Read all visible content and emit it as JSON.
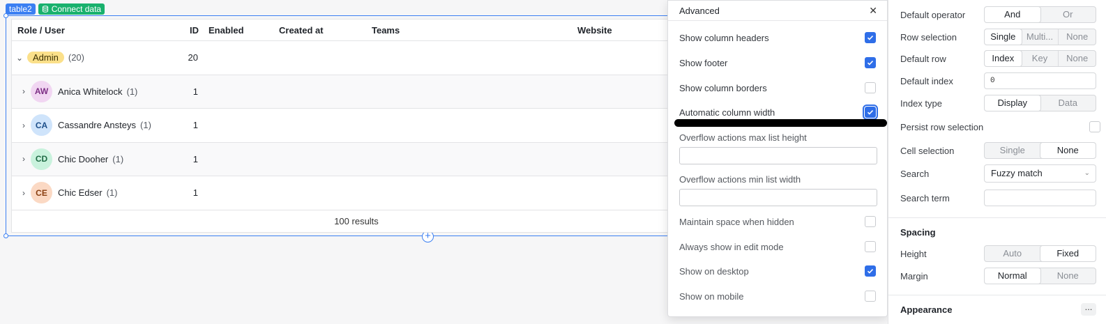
{
  "component": {
    "name_tag": "table2",
    "connect_label": "Connect data"
  },
  "table": {
    "columns": [
      "Role / User",
      "ID",
      "Enabled",
      "Created at",
      "Teams",
      "Website"
    ],
    "group": {
      "label": "Admin",
      "count": "(20)",
      "id": "20"
    },
    "rows": [
      {
        "initials": "AW",
        "name": "Anica Whitelock",
        "count": "(1)",
        "id": "1",
        "avatar_bg": "#f1d6f2",
        "avatar_fg": "#7d2f85"
      },
      {
        "initials": "CA",
        "name": "Cassandre Ansteys",
        "count": "(1)",
        "id": "1",
        "avatar_bg": "#cfe4fb",
        "avatar_fg": "#1d4f8a"
      },
      {
        "initials": "CD",
        "name": "Chic Dooher",
        "count": "(1)",
        "id": "1",
        "avatar_bg": "#c9f2dd",
        "avatar_fg": "#1f6b45"
      },
      {
        "initials": "CE",
        "name": "Chic Edser",
        "count": "(1)",
        "id": "1",
        "avatar_bg": "#fbd9c4",
        "avatar_fg": "#8a3f12"
      }
    ],
    "footer": "100 results"
  },
  "advanced": {
    "title": "Advanced",
    "show_column_headers": "Show column headers",
    "show_footer": "Show footer",
    "show_column_borders": "Show column borders",
    "automatic_column_width": "Automatic column width",
    "overflow_max_height": "Overflow actions max list height",
    "overflow_min_width": "Overflow actions min list width",
    "maintain_space": "Maintain space when hidden",
    "always_show_edit": "Always show in edit mode",
    "show_desktop": "Show on desktop",
    "show_mobile": "Show on mobile"
  },
  "inspector": {
    "default_operator": {
      "label": "Default operator",
      "options": [
        "And",
        "Or"
      ],
      "selected": "And"
    },
    "row_selection": {
      "label": "Row selection",
      "options": [
        "Single",
        "Multi...",
        "None"
      ],
      "selected": "Single"
    },
    "default_row": {
      "label": "Default row",
      "options": [
        "Index",
        "Key",
        "None"
      ],
      "selected": "Index"
    },
    "default_index": {
      "label": "Default index",
      "value": "0"
    },
    "index_type": {
      "label": "Index type",
      "options": [
        "Display",
        "Data"
      ],
      "selected": "Display"
    },
    "persist_row_selection": {
      "label": "Persist row selection"
    },
    "cell_selection": {
      "label": "Cell selection",
      "options": [
        "Single",
        "None"
      ],
      "selected": "None"
    },
    "search": {
      "label": "Search",
      "value": "Fuzzy match"
    },
    "search_term": {
      "label": "Search term",
      "value": ""
    },
    "spacing_title": "Spacing",
    "height": {
      "label": "Height",
      "options": [
        "Auto",
        "Fixed"
      ],
      "selected": "Fixed"
    },
    "margin": {
      "label": "Margin",
      "options": [
        "Normal",
        "None"
      ],
      "selected": "Normal"
    },
    "appearance_title": "Appearance",
    "more_label": "..."
  }
}
